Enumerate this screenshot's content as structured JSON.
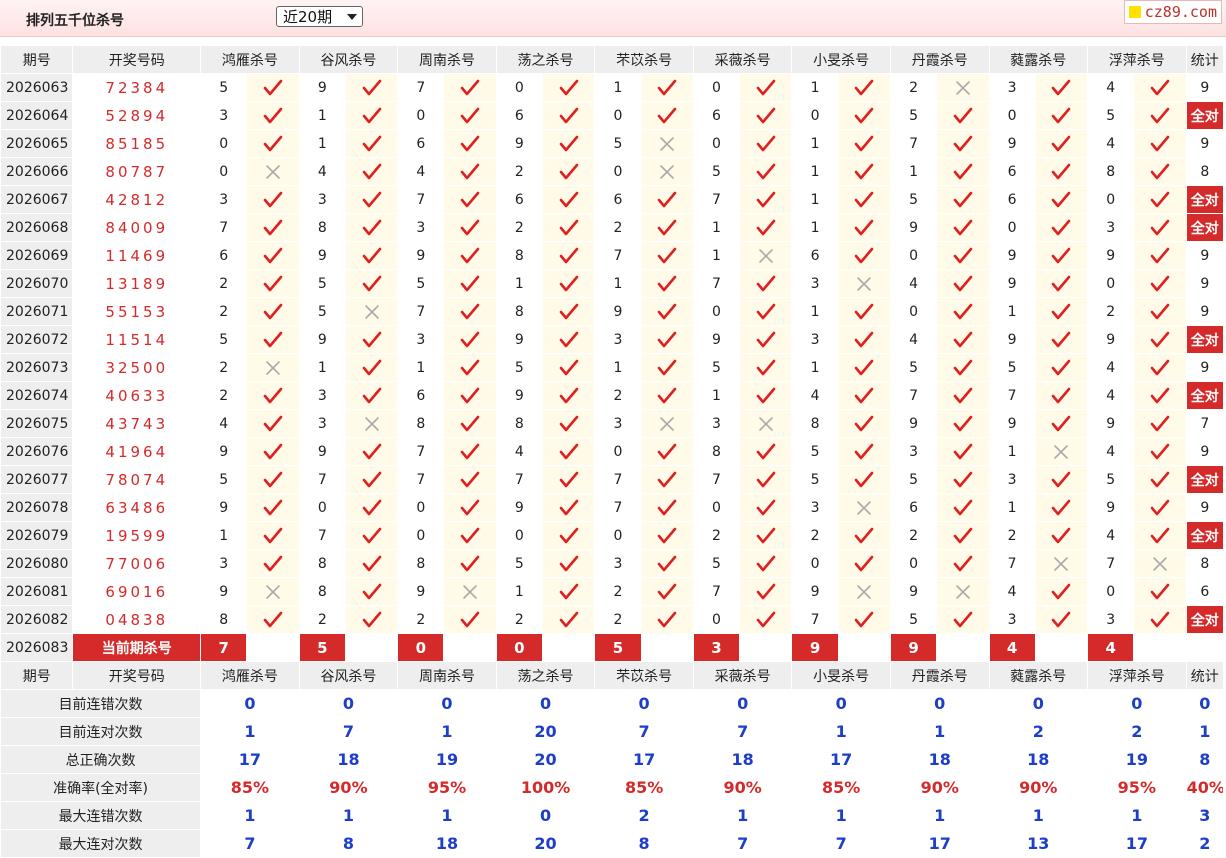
{
  "page": {
    "title": "排列五千位杀号",
    "range_select": "近20期",
    "logo_text": "cz89.com"
  },
  "table": {
    "header": [
      "期号",
      "开奖号码",
      "鸿雁杀号",
      "谷风杀号",
      "周南杀号",
      "荡之杀号",
      "芣苡杀号",
      "采薇杀号",
      "小旻杀号",
      "丹霞杀号",
      "蕤露杀号",
      "浮萍杀号",
      "统计"
    ],
    "rows": [
      {
        "period": "2026063",
        "draw": "72384",
        "kills": [
          "5",
          "9",
          "7",
          "0",
          "1",
          "0",
          "1",
          "2",
          "3",
          "4"
        ],
        "marks": [
          "right",
          "right",
          "right",
          "right",
          "right",
          "right",
          "right",
          "wrong",
          "right",
          "right"
        ],
        "stat": "9"
      },
      {
        "period": "2026064",
        "draw": "52894",
        "kills": [
          "3",
          "1",
          "0",
          "6",
          "0",
          "6",
          "0",
          "5",
          "0",
          "5"
        ],
        "marks": [
          "right",
          "right",
          "right",
          "right",
          "right",
          "right",
          "right",
          "right",
          "right",
          "right"
        ],
        "stat": "全对"
      },
      {
        "period": "2026065",
        "draw": "85185",
        "kills": [
          "0",
          "1",
          "6",
          "9",
          "5",
          "0",
          "1",
          "7",
          "9",
          "4"
        ],
        "marks": [
          "right",
          "right",
          "right",
          "right",
          "wrong",
          "right",
          "right",
          "right",
          "right",
          "right"
        ],
        "stat": "9"
      },
      {
        "period": "2026066",
        "draw": "80787",
        "kills": [
          "0",
          "4",
          "4",
          "2",
          "0",
          "5",
          "1",
          "1",
          "6",
          "8"
        ],
        "marks": [
          "wrong",
          "right",
          "right",
          "right",
          "wrong",
          "right",
          "right",
          "right",
          "right",
          "right"
        ],
        "stat": "8"
      },
      {
        "period": "2026067",
        "draw": "42812",
        "kills": [
          "3",
          "3",
          "7",
          "6",
          "6",
          "7",
          "1",
          "5",
          "6",
          "0"
        ],
        "marks": [
          "right",
          "right",
          "right",
          "right",
          "right",
          "right",
          "right",
          "right",
          "right",
          "right"
        ],
        "stat": "全对"
      },
      {
        "period": "2026068",
        "draw": "84009",
        "kills": [
          "7",
          "8",
          "3",
          "2",
          "2",
          "1",
          "1",
          "9",
          "0",
          "3"
        ],
        "marks": [
          "right",
          "right",
          "right",
          "right",
          "right",
          "right",
          "right",
          "right",
          "right",
          "right"
        ],
        "stat": "全对"
      },
      {
        "period": "2026069",
        "draw": "11469",
        "kills": [
          "6",
          "9",
          "9",
          "8",
          "7",
          "1",
          "6",
          "0",
          "9",
          "9"
        ],
        "marks": [
          "right",
          "right",
          "right",
          "right",
          "right",
          "wrong",
          "right",
          "right",
          "right",
          "right"
        ],
        "stat": "9"
      },
      {
        "period": "2026070",
        "draw": "13189",
        "kills": [
          "2",
          "5",
          "5",
          "1",
          "1",
          "7",
          "3",
          "4",
          "9",
          "0"
        ],
        "marks": [
          "right",
          "right",
          "right",
          "right",
          "right",
          "right",
          "wrong",
          "right",
          "right",
          "right"
        ],
        "stat": "9"
      },
      {
        "period": "2026071",
        "draw": "55153",
        "kills": [
          "2",
          "5",
          "7",
          "8",
          "9",
          "0",
          "1",
          "0",
          "1",
          "2"
        ],
        "marks": [
          "right",
          "wrong",
          "right",
          "right",
          "right",
          "right",
          "right",
          "right",
          "right",
          "right"
        ],
        "stat": "9"
      },
      {
        "period": "2026072",
        "draw": "11514",
        "kills": [
          "5",
          "9",
          "3",
          "9",
          "3",
          "9",
          "3",
          "4",
          "9",
          "9"
        ],
        "marks": [
          "right",
          "right",
          "right",
          "right",
          "right",
          "right",
          "right",
          "right",
          "right",
          "right"
        ],
        "stat": "全对"
      },
      {
        "period": "2026073",
        "draw": "32500",
        "kills": [
          "2",
          "1",
          "1",
          "5",
          "1",
          "5",
          "1",
          "5",
          "5",
          "4"
        ],
        "marks": [
          "wrong",
          "right",
          "right",
          "right",
          "right",
          "right",
          "right",
          "right",
          "right",
          "right"
        ],
        "stat": "9"
      },
      {
        "period": "2026074",
        "draw": "40633",
        "kills": [
          "2",
          "3",
          "6",
          "9",
          "2",
          "1",
          "4",
          "7",
          "7",
          "4"
        ],
        "marks": [
          "right",
          "right",
          "right",
          "right",
          "right",
          "right",
          "right",
          "right",
          "right",
          "right"
        ],
        "stat": "全对"
      },
      {
        "period": "2026075",
        "draw": "43743",
        "kills": [
          "4",
          "3",
          "8",
          "8",
          "3",
          "3",
          "8",
          "9",
          "9",
          "9"
        ],
        "marks": [
          "right",
          "wrong",
          "right",
          "right",
          "wrong",
          "wrong",
          "right",
          "right",
          "right",
          "right"
        ],
        "stat": "7"
      },
      {
        "period": "2026076",
        "draw": "41964",
        "kills": [
          "9",
          "9",
          "7",
          "4",
          "0",
          "8",
          "5",
          "3",
          "1",
          "4"
        ],
        "marks": [
          "right",
          "right",
          "right",
          "right",
          "right",
          "right",
          "right",
          "right",
          "wrong",
          "right"
        ],
        "stat": "9"
      },
      {
        "period": "2026077",
        "draw": "78074",
        "kills": [
          "5",
          "7",
          "7",
          "7",
          "7",
          "7",
          "5",
          "5",
          "3",
          "5"
        ],
        "marks": [
          "right",
          "right",
          "right",
          "right",
          "right",
          "right",
          "right",
          "right",
          "right",
          "right"
        ],
        "stat": "全对"
      },
      {
        "period": "2026078",
        "draw": "63486",
        "kills": [
          "9",
          "0",
          "0",
          "9",
          "7",
          "0",
          "3",
          "6",
          "1",
          "9"
        ],
        "marks": [
          "right",
          "right",
          "right",
          "right",
          "right",
          "right",
          "wrong",
          "right",
          "right",
          "right"
        ],
        "stat": "9"
      },
      {
        "period": "2026079",
        "draw": "19599",
        "kills": [
          "1",
          "7",
          "0",
          "0",
          "0",
          "2",
          "2",
          "2",
          "2",
          "4"
        ],
        "marks": [
          "right",
          "right",
          "right",
          "right",
          "right",
          "right",
          "right",
          "right",
          "right",
          "right"
        ],
        "stat": "全对"
      },
      {
        "period": "2026080",
        "draw": "77006",
        "kills": [
          "3",
          "8",
          "8",
          "5",
          "3",
          "5",
          "0",
          "0",
          "7",
          "7"
        ],
        "marks": [
          "right",
          "right",
          "right",
          "right",
          "right",
          "right",
          "right",
          "right",
          "wrong",
          "wrong"
        ],
        "stat": "8"
      },
      {
        "period": "2026081",
        "draw": "69016",
        "kills": [
          "9",
          "8",
          "9",
          "1",
          "2",
          "7",
          "9",
          "9",
          "4",
          "0"
        ],
        "marks": [
          "wrong",
          "right",
          "wrong",
          "right",
          "right",
          "right",
          "wrong",
          "wrong",
          "right",
          "right"
        ],
        "stat": "6"
      },
      {
        "period": "2026082",
        "draw": "04838",
        "kills": [
          "8",
          "2",
          "2",
          "2",
          "2",
          "0",
          "7",
          "5",
          "3",
          "3"
        ],
        "marks": [
          "right",
          "right",
          "right",
          "right",
          "right",
          "right",
          "right",
          "right",
          "right",
          "right"
        ],
        "stat": "全对"
      }
    ],
    "current": {
      "period": "2026083",
      "label": "当前期杀号",
      "kills": [
        "7",
        "5",
        "0",
        "0",
        "5",
        "3",
        "9",
        "9",
        "4",
        "4"
      ]
    },
    "stats": [
      {
        "label": "目前连错次数",
        "values": [
          "0",
          "0",
          "0",
          "0",
          "0",
          "0",
          "0",
          "0",
          "0",
          "0",
          "0"
        ]
      },
      {
        "label": "目前连对次数",
        "values": [
          "1",
          "7",
          "1",
          "20",
          "7",
          "7",
          "1",
          "1",
          "2",
          "2",
          "1"
        ]
      },
      {
        "label": "总正确次数",
        "values": [
          "17",
          "18",
          "19",
          "20",
          "17",
          "18",
          "17",
          "18",
          "18",
          "19",
          "8"
        ]
      },
      {
        "label": "准确率(全对率)",
        "values": [
          "85%",
          "90%",
          "95%",
          "100%",
          "85%",
          "90%",
          "85%",
          "90%",
          "90%",
          "95%",
          "40%"
        ],
        "red": true
      },
      {
        "label": "最大连错次数",
        "values": [
          "1",
          "1",
          "1",
          "0",
          "2",
          "1",
          "1",
          "1",
          "1",
          "1",
          "3"
        ]
      },
      {
        "label": "最大连对次数",
        "values": [
          "7",
          "8",
          "18",
          "20",
          "8",
          "7",
          "7",
          "17",
          "13",
          "17",
          "2"
        ]
      }
    ]
  },
  "colors": {
    "accent": "#d42a2a",
    "stat_blue": "#1c3ec8",
    "mark_bg": "#fffbe8",
    "header_bg": "#eeeeee"
  },
  "icons": {
    "right": "check-icon",
    "wrong": "cross-icon"
  }
}
